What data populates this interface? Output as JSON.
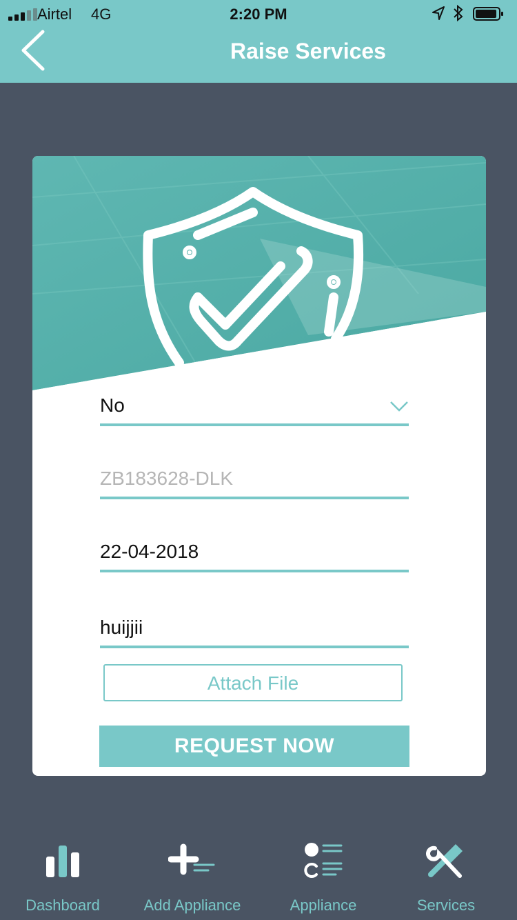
{
  "status_bar": {
    "carrier": "Airtel",
    "network": "4G",
    "time": "2:20 PM"
  },
  "header": {
    "title": "Raise Services"
  },
  "form": {
    "select_value": "No",
    "serial_placeholder": "ZB183628-DLK",
    "date_value": "22-04-2018",
    "description_value": "huijjii",
    "attach_label": "Attach File",
    "submit_label": "REQUEST NOW"
  },
  "tabbar": {
    "items": [
      {
        "label": "Dashboard",
        "icon": "bar-chart-icon"
      },
      {
        "label": "Add Appliance",
        "icon": "plus-list-icon"
      },
      {
        "label": "Appliance",
        "icon": "list-icon"
      },
      {
        "label": "Services",
        "icon": "tools-icon"
      }
    ]
  },
  "colors": {
    "accent": "#79c8c8",
    "background": "#4a5463",
    "card": "#ffffff"
  }
}
